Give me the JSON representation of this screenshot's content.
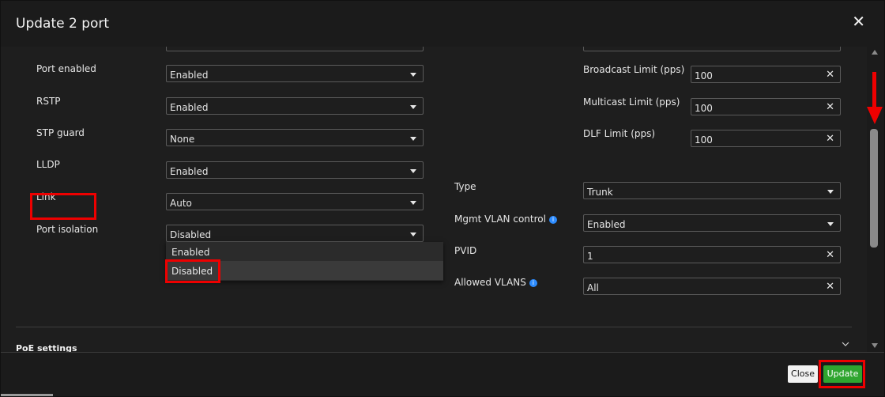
{
  "dialog": {
    "title": "Update 2 port"
  },
  "left": [
    {
      "label": "Port enabled",
      "value": "Enabled"
    },
    {
      "label": "RSTP",
      "value": "Enabled"
    },
    {
      "label": "STP guard",
      "value": "None"
    },
    {
      "label": "LLDP",
      "value": "Enabled"
    },
    {
      "label": "Link",
      "value": "Auto"
    },
    {
      "label": "Port isolation",
      "value": "Disabled"
    }
  ],
  "dropdown": {
    "options": [
      "Enabled",
      "Disabled"
    ]
  },
  "limits": [
    {
      "label": "Broadcast Limit (pps)",
      "value": "100"
    },
    {
      "label": "Multicast Limit (pps)",
      "value": "100"
    },
    {
      "label": "DLF Limit (pps)",
      "value": "100"
    }
  ],
  "vlan": {
    "type": {
      "label": "Type",
      "value": "Trunk"
    },
    "mgmt": {
      "label": "Mgmt VLAN control",
      "value": "Enabled"
    },
    "pvid": {
      "label": "PVID",
      "value": "1"
    },
    "allowed": {
      "label": "Allowed VLANS",
      "value": "All"
    }
  },
  "icons": {
    "close": "close-icon",
    "clear": "clear-icon",
    "caret": "caret-down-icon",
    "info": "info-icon",
    "chevron": "chevron-down-icon",
    "arrow": "scroll-down-arrow"
  },
  "poe": {
    "label": "PoE settings"
  },
  "buttons": {
    "close": "Close",
    "update": "Update"
  },
  "glyphs": {
    "close": "✕",
    "clear": "✕",
    "info": "i"
  },
  "colors": {
    "accent_green": "#2fa52f",
    "highlight_red": "#e00000",
    "info_blue": "#2d8cff"
  }
}
